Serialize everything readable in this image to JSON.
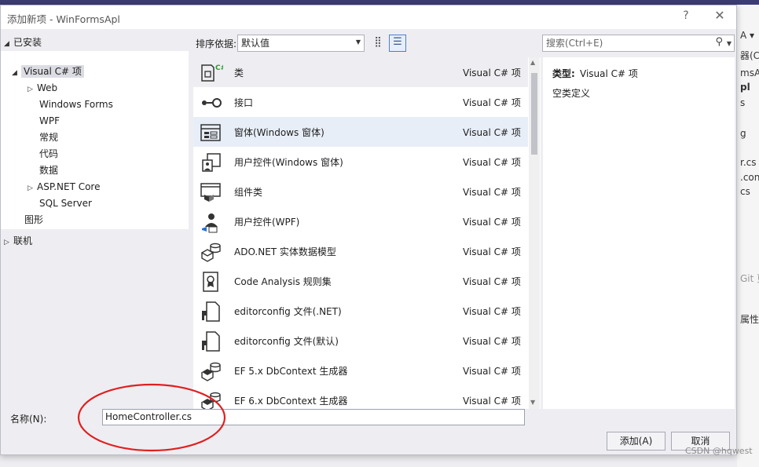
{
  "background": {
    "fragments": [
      "A ▾",
      "器(Ctr",
      "msA",
      "pl",
      "s",
      "g",
      "r.cs",
      ".conf",
      "cs",
      "Git 更",
      "属性"
    ]
  },
  "dialog": {
    "title": "添加新项 - WinFormsApl",
    "help": "?",
    "close": "✕"
  },
  "tree": {
    "header": "已安装",
    "root": "Visual C# 项",
    "items": [
      "Web",
      "Windows Forms",
      "WPF",
      "常规",
      "代码",
      "数据",
      "ASP.NET Core",
      "SQL Server"
    ],
    "graphics": "图形",
    "online": "联机"
  },
  "toolbar": {
    "sort_label": "排序依据:",
    "sort_value": "默认值",
    "search_placeholder": "搜索(Ctrl+E)"
  },
  "templates": [
    {
      "name": "类",
      "lang": "Visual C# 项",
      "icon": "class-icon"
    },
    {
      "name": "接口",
      "lang": "Visual C# 项",
      "icon": "interface-icon"
    },
    {
      "name": "窗体(Windows 窗体)",
      "lang": "Visual C# 项",
      "icon": "form-icon"
    },
    {
      "name": "用户控件(Windows 窗体)",
      "lang": "Visual C# 项",
      "icon": "user-control-icon"
    },
    {
      "name": "组件类",
      "lang": "Visual C# 项",
      "icon": "component-icon"
    },
    {
      "name": "用户控件(WPF)",
      "lang": "Visual C# 项",
      "icon": "wpf-user-control-icon"
    },
    {
      "name": "ADO.NET 实体数据模型",
      "lang": "Visual C# 项",
      "icon": "entity-model-icon"
    },
    {
      "name": "Code Analysis 规则集",
      "lang": "Visual C# 项",
      "icon": "rule-set-icon"
    },
    {
      "name": "editorconfig 文件(.NET)",
      "lang": "Visual C# 项",
      "icon": "editorconfig-icon"
    },
    {
      "name": "editorconfig 文件(默认)",
      "lang": "Visual C# 项",
      "icon": "editorconfig-icon"
    },
    {
      "name": "EF 5.x DbContext 生成器",
      "lang": "Visual C# 项",
      "icon": "dbcontext-icon"
    },
    {
      "name": "EF 6.x DbContext 生成器",
      "lang": "Visual C# 项",
      "icon": "dbcontext-icon"
    }
  ],
  "details": {
    "type_label": "类型:",
    "type_value": "Visual C# 项",
    "description": "空类定义"
  },
  "bottom": {
    "name_label": "名称(N):",
    "name_value": "HomeController.cs",
    "add_label": "添加(A)",
    "cancel_label": "取消"
  },
  "watermark": "CSDN @hqwest",
  "colors": {
    "selection": "#eeeef2",
    "hover": "#e8eef8",
    "annotation": "#e02020",
    "accent": "#4f7ec4"
  }
}
